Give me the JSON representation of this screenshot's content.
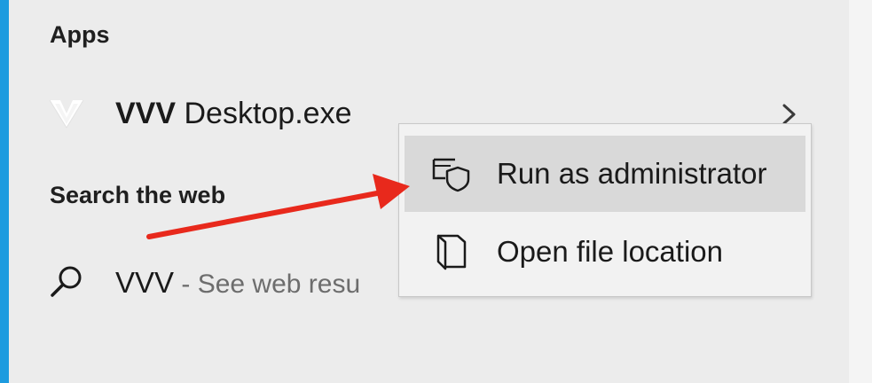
{
  "sections": {
    "apps_heading": "Apps",
    "web_heading": "Search the web"
  },
  "app_result": {
    "name_bold": "VVV",
    "name_rest": " Desktop.exe",
    "logo_icon": "vvv-logo-icon",
    "expand_icon": "chevron-right-icon"
  },
  "web_result": {
    "query": "VVV",
    "suffix": " - See web resu",
    "icon": "search-icon"
  },
  "context_menu": {
    "items": [
      {
        "label": "Run as administrator",
        "icon": "run-as-admin-shield-icon",
        "highlighted": true
      },
      {
        "label": "Open file location",
        "icon": "folder-open-icon",
        "highlighted": false
      }
    ]
  },
  "colors": {
    "accent": "#1d9bdf",
    "panel": "#ececec",
    "menu_bg": "#f2f2f2",
    "menu_hover": "#d9d9d9",
    "annotation_arrow": "#e8291c"
  }
}
